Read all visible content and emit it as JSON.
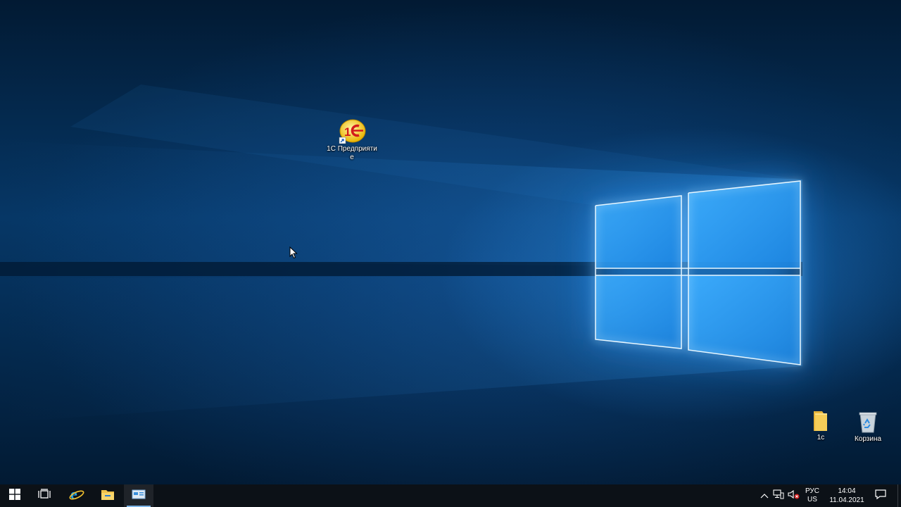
{
  "desktop": {
    "icons": [
      {
        "label": "1С Предприятие",
        "icon": "1c-enterprise-shortcut-icon"
      },
      {
        "label": "1c",
        "icon": "folder-icon"
      },
      {
        "label": "Корзина",
        "icon": "recycle-bin-icon"
      }
    ]
  },
  "taskbar": {
    "buttons": [
      {
        "icon": "windows-start-icon"
      },
      {
        "icon": "task-view-icon"
      },
      {
        "icon": "internet-explorer-icon"
      },
      {
        "icon": "file-explorer-icon"
      },
      {
        "icon": "server-manager-icon",
        "active": true
      }
    ],
    "tray": {
      "icons": [
        "chevron-up-icon",
        "network-icon",
        "volume-muted-icon"
      ],
      "language_line1": "РУС",
      "language_line2": "US",
      "time": "14:04",
      "date": "11.04.2021",
      "notification_icon": "action-center-icon"
    }
  },
  "colors": {
    "accent": "#0078d7",
    "taskbar": "#0c1117",
    "logo_glow": "#39b6ff"
  }
}
